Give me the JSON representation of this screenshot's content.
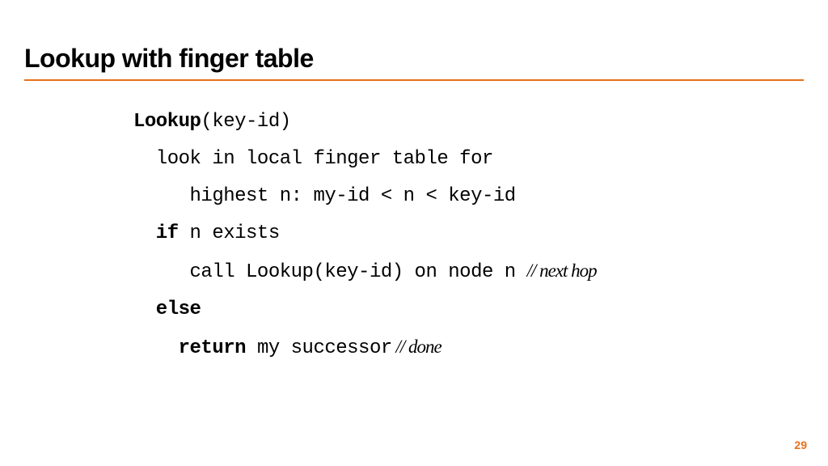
{
  "title": "Lookup with finger table",
  "pageNumber": "29",
  "code": {
    "l0": {
      "kw": "Lookup",
      "rest": "(key-id)"
    },
    "l1": "  look in local finger table for",
    "l2": "     highest n: my-id < n < key-id",
    "l3": {
      "kw": "  if",
      "rest": " n exists"
    },
    "l4": {
      "text": "     call Lookup(key-id) on node n ",
      "cm": "// next hop"
    },
    "l5": {
      "kw": "  else"
    },
    "l6": {
      "pad": "    ",
      "kw": "return ",
      "rest": "my successor",
      "cm": " // done"
    }
  }
}
